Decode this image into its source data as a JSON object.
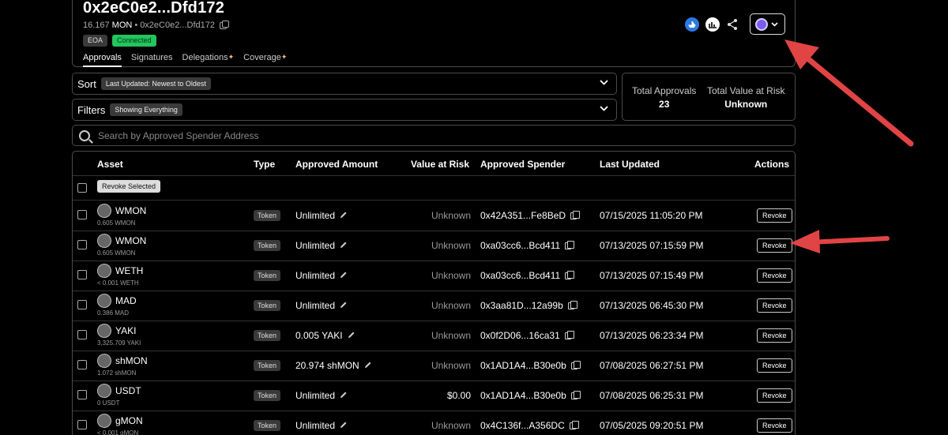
{
  "header": {
    "address": "0x2eC0e2...Dfd172",
    "balance": "16.167",
    "balance_unit": "MON",
    "sub_sep": "•",
    "sub_address": "0x2eC0e2...Dfd172",
    "badge_eoa": "EOA",
    "badge_connected": "Connected",
    "tabs": [
      {
        "label": "Approvals"
      },
      {
        "label": "Signatures"
      },
      {
        "label": "Delegations"
      },
      {
        "label": "Coverage"
      }
    ],
    "spark": "✦"
  },
  "sort": {
    "label": "Sort",
    "value": "Last Updated: Newest to Oldest"
  },
  "filters": {
    "label": "Filters",
    "value": "Showing Everything"
  },
  "totals": {
    "approvals_label": "Total Approvals",
    "approvals_value": "23",
    "risk_label": "Total Value at Risk",
    "risk_value": "Unknown"
  },
  "search": {
    "placeholder": "Search by Approved Spender Address"
  },
  "table": {
    "headers": {
      "asset": "Asset",
      "type": "Type",
      "amount": "Approved Amount",
      "risk": "Value at Risk",
      "spender": "Approved Spender",
      "updated": "Last Updated",
      "actions": "Actions"
    },
    "revoke_selected": "Revoke Selected",
    "revoke_label": "Revoke",
    "rows": [
      {
        "asset": "WMON",
        "balance": "0.605 WMON",
        "type": "Token",
        "amount": "Unlimited",
        "risk": "Unknown",
        "spender": "0x42A351...Fe8BeD",
        "updated": "07/15/2025 11:05:20 PM"
      },
      {
        "asset": "WMON",
        "balance": "0.605 WMON",
        "type": "Token",
        "amount": "Unlimited",
        "risk": "Unknown",
        "spender": "0xa03cc6...Bcd411",
        "updated": "07/13/2025 07:15:59 PM"
      },
      {
        "asset": "WETH",
        "balance": "< 0.001 WETH",
        "type": "Token",
        "amount": "Unlimited",
        "risk": "Unknown",
        "spender": "0xa03cc6...Bcd411",
        "updated": "07/13/2025 07:15:49 PM"
      },
      {
        "asset": "MAD",
        "balance": "0.386 MAD",
        "type": "Token",
        "amount": "Unlimited",
        "risk": "Unknown",
        "spender": "0x3aa81D...12a99b",
        "updated": "07/13/2025 06:45:30 PM"
      },
      {
        "asset": "YAKI",
        "balance": "3,325.709 YAKI",
        "type": "Token",
        "amount": "0.005 YAKI",
        "risk": "Unknown",
        "spender": "0x0f2D06...16ca31",
        "updated": "07/13/2025 06:23:34 PM"
      },
      {
        "asset": "shMON",
        "balance": "1.072 shMON",
        "type": "Token",
        "amount": "20.974 shMON",
        "risk": "Unknown",
        "spender": "0x1AD1A4...B30e0b",
        "updated": "07/08/2025 06:27:51 PM"
      },
      {
        "asset": "USDT",
        "balance": "0 USDT",
        "type": "Token",
        "amount": "Unlimited",
        "risk": "$0.00",
        "spender": "0x1AD1A4...B30e0b",
        "updated": "07/08/2025 06:25:31 PM"
      },
      {
        "asset": "gMON",
        "balance": "< 0.001 gMON",
        "type": "Token",
        "amount": "Unlimited",
        "risk": "Unknown",
        "spender": "0x4C136f...A356DC",
        "updated": "07/05/2025 09:20:51 PM"
      }
    ]
  },
  "colors": {
    "background": "#000000",
    "border": "#4a4a4a",
    "connected": "#22c55e",
    "arrow": "#e04444",
    "chain": "#7c5cf0"
  },
  "icons": {
    "copy": "copy-icon",
    "pencil": "pencil-icon",
    "share": "share-icon",
    "search": "search-icon",
    "chevron": "chevron-down-icon"
  }
}
